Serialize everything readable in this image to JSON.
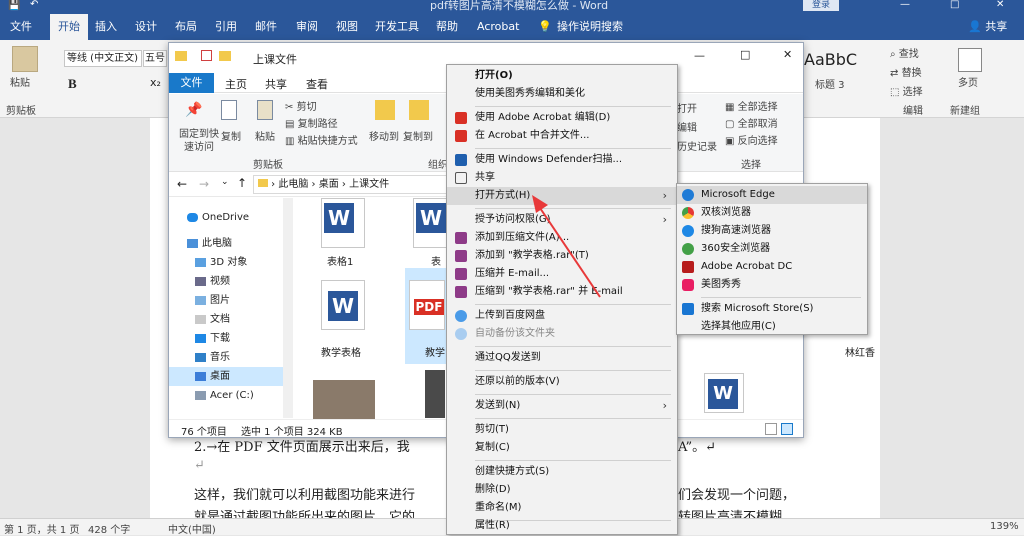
{
  "word": {
    "title": "pdf转图片高清不模糊怎么做 - Word",
    "login": "登录",
    "tabs": [
      "文件",
      "开始",
      "插入",
      "设计",
      "布局",
      "引用",
      "邮件",
      "审阅",
      "视图",
      "开发工具",
      "帮助",
      "Acrobat",
      "操作说明搜索"
    ],
    "share": "共享",
    "ribbon": {
      "paste": "粘贴",
      "clipboard": "剪贴板",
      "font_name": "等线 (中文正文)",
      "font_size": "五号",
      "style_sample": "AaBbC",
      "style_name": "标题 3",
      "find": "查找",
      "replace": "替换",
      "select": "选择",
      "edit": "编辑",
      "multipage": "多页",
      "newgroup": "新建组"
    },
    "doc": {
      "line1": "2.→在 PDF 文件页面展示出来后，我",
      "line1b": "A”。↵",
      "line2": "↵",
      "line3": "这样，我们就可以利用截图功能来进行",
      "line3b": "们会发现一个问题，",
      "line4": "就是通过截图功能所出来的图片，它的",
      "line4b": "转图片高清不模糊"
    },
    "status": {
      "page": "第 1 页，共 1 页",
      "words": "428 个字",
      "lang": "中文(中国)",
      "zoom": "139%"
    }
  },
  "explorer": {
    "title": "上课文件",
    "tabs": [
      "文件",
      "主页",
      "共享",
      "查看"
    ],
    "ribbon": {
      "pin": "固定到快速访问",
      "copy": "复制",
      "paste": "粘贴",
      "cut": "剪切",
      "copy_path": "复制路径",
      "paste_shortcut": "粘贴快捷方式",
      "move_to": "移动到",
      "copy_to": "复制到",
      "clipboard": "剪贴板",
      "organize": "组织",
      "open": "打开",
      "edit": "编辑",
      "history": "历史记录",
      "select_all": "全部选择",
      "select_none": "全部取消",
      "invert": "反向选择",
      "select": "选择"
    },
    "breadcrumb": [
      "此电脑",
      "桌面",
      "上课文件"
    ],
    "sidebar": [
      "OneDrive",
      "此电脑",
      "3D 对象",
      "视频",
      "图片",
      "文档",
      "下载",
      "音乐",
      "桌面",
      "Acer (C:)"
    ],
    "files": [
      "表格1",
      "表",
      "教学表格",
      "教学",
      "林红香"
    ],
    "status": {
      "count": "76 个项目",
      "selected": "选中 1 个项目  324 KB"
    }
  },
  "context_menu": {
    "items": [
      "打开(O)",
      "使用美图秀秀编辑和美化",
      "使用 Adobe Acrobat 编辑(D)",
      "在 Acrobat 中合并文件...",
      "使用 Windows Defender扫描...",
      "共享",
      "打开方式(H)",
      "授予访问权限(G)",
      "添加到压缩文件(A)...",
      "添加到 \"教学表格.rar\"(T)",
      "压缩并 E-mail...",
      "压缩到 \"教学表格.rar\" 并 E-mail",
      "上传到百度网盘",
      "自动备份该文件夹",
      "通过QQ发送到",
      "还原以前的版本(V)",
      "发送到(N)",
      "剪切(T)",
      "复制(C)",
      "创建快捷方式(S)",
      "删除(D)",
      "重命名(M)",
      "属性(R)"
    ]
  },
  "open_with": {
    "items": [
      "Microsoft Edge",
      "双核浏览器",
      "搜狗高速浏览器",
      "360安全浏览器",
      "Adobe Acrobat DC",
      "美图秀秀",
      "搜索 Microsoft Store(S)",
      "选择其他应用(C)"
    ]
  },
  "colors": {
    "word_blue": "#2b579a",
    "explorer_blue": "#1979ca",
    "annotation_red": "#e8393a"
  }
}
